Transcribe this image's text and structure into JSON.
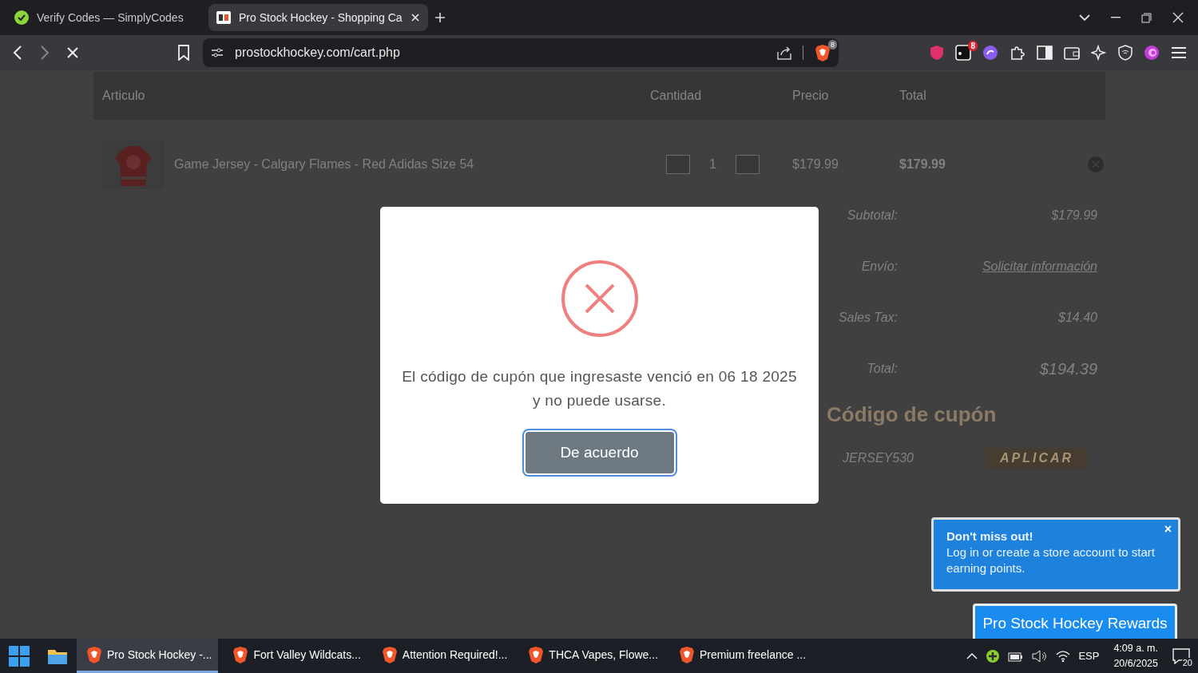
{
  "browser": {
    "tabs": [
      {
        "title": "Verify Codes — SimplyCodes",
        "selected": false
      },
      {
        "title": "Pro Stock Hockey - Shopping Ca",
        "selected": true
      }
    ],
    "url": "prostockhockey.com/cart.php",
    "shields_count": "8",
    "extension_badge": "8"
  },
  "cart": {
    "columns": [
      "Articulo",
      "Cantidad",
      "Precio",
      "Total"
    ],
    "items": [
      {
        "name": "Game Jersey - Calgary Flames - Red Adidas Size 54",
        "quantity": "1",
        "price": "$179.99",
        "total": "$179.99"
      }
    ],
    "summary": [
      {
        "label": "Subtotal:",
        "value": "$179.99",
        "kind": "text"
      },
      {
        "label": "Envío:",
        "value": "Solicitar información",
        "kind": "link"
      },
      {
        "label": "Sales Tax:",
        "value": "$14.40",
        "kind": "text"
      },
      {
        "label": "Total:",
        "value": "$194.39",
        "kind": "total"
      }
    ],
    "coupon": {
      "title": "Código de cupón",
      "code": "JERSEY530",
      "button": "APLICAR"
    }
  },
  "dialog": {
    "message": "El código de cupón que ingresaste venció en 06 18 2025 y no puede usarse.",
    "button": "De acuerdo"
  },
  "rewards": {
    "title": "Don't miss out!",
    "text": "Log in or create a store account to start earning points.",
    "close": "×",
    "button": "Pro Stock Hockey Rewards"
  },
  "taskbar": {
    "apps": [
      {
        "label": "Pro Stock Hockey -...",
        "selected": true
      },
      {
        "label": "Fort Valley Wildcats...",
        "selected": false
      },
      {
        "label": "Attention Required!...",
        "selected": false
      },
      {
        "label": "THCA Vapes, Flowe...",
        "selected": false
      },
      {
        "label": "Premium freelance ...",
        "selected": false
      }
    ],
    "language": "ESP",
    "time": "4:09 a. m.",
    "date": "20/6/2025",
    "notifications": "20"
  }
}
